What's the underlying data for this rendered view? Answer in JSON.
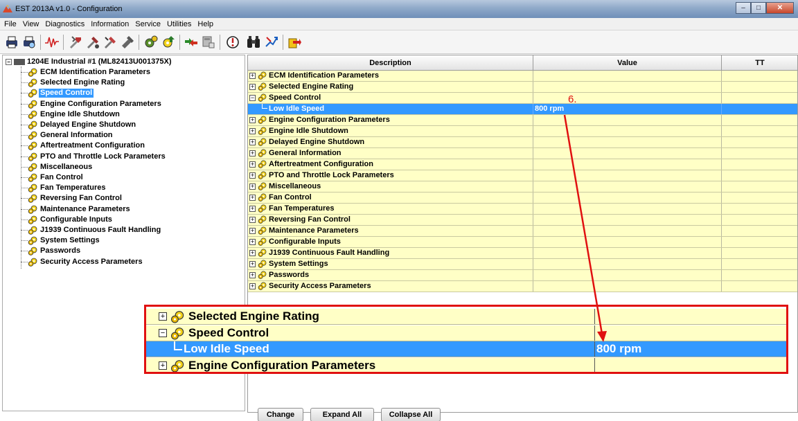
{
  "window": {
    "title": "EST 2013A v1.0 - Configuration",
    "controls": {
      "minimize": "–",
      "maximize": "□",
      "close": "✕"
    }
  },
  "menu": [
    "File",
    "View",
    "Diagnostics",
    "Information",
    "Service",
    "Utilities",
    "Help"
  ],
  "toolbar_icons": [
    "print-icon",
    "print-preview-icon",
    "waveform-icon",
    "tools-icon-1",
    "tools-icon-2",
    "tools-icon-3",
    "tools-icon-4",
    "gear-config-icon",
    "gear-upload-icon",
    "connect-icon",
    "module-icon",
    "fault-icon",
    "binoculars-icon",
    "signal-icon",
    "export-icon"
  ],
  "tree": {
    "root": "1204E Industrial #1 (ML82413U001375X)",
    "items": [
      "ECM Identification Parameters",
      "Selected Engine Rating",
      "Speed Control",
      "Engine Configuration Parameters",
      "Engine Idle Shutdown",
      "Delayed Engine Shutdown",
      "General Information",
      "Aftertreatment Configuration",
      "PTO and Throttle Lock Parameters",
      "Miscellaneous",
      "Fan Control",
      "Fan Temperatures",
      "Reversing Fan Control",
      "Maintenance Parameters",
      "Configurable Inputs",
      "J1939 Continuous Fault Handling",
      "System Settings",
      "Passwords",
      "Security Access Parameters"
    ],
    "selected": "Speed Control"
  },
  "grid": {
    "headers": {
      "description": "Description",
      "value": "Value",
      "tt": "TT"
    },
    "rows": [
      {
        "desc": "ECM Identification Parameters",
        "value": "",
        "expander": "⊞"
      },
      {
        "desc": "Selected Engine Rating",
        "value": "",
        "expander": "⊞"
      },
      {
        "desc": "Speed Control",
        "value": "",
        "expander": "⊟"
      },
      {
        "desc": "Low Idle Speed",
        "value": "800 rpm",
        "child": true
      },
      {
        "desc": "Engine Configuration Parameters",
        "value": "",
        "expander": "⊞"
      },
      {
        "desc": "Engine Idle Shutdown",
        "value": "",
        "expander": "⊞"
      },
      {
        "desc": "Delayed Engine Shutdown",
        "value": "",
        "expander": "⊞"
      },
      {
        "desc": "General Information",
        "value": "",
        "expander": "⊞"
      },
      {
        "desc": "Aftertreatment Configuration",
        "value": "",
        "expander": "⊞"
      },
      {
        "desc": "PTO and Throttle Lock Parameters",
        "value": "",
        "expander": "⊞"
      },
      {
        "desc": "Miscellaneous",
        "value": "",
        "expander": "⊞"
      },
      {
        "desc": "Fan Control",
        "value": "",
        "expander": "⊞"
      },
      {
        "desc": "Fan Temperatures",
        "value": "",
        "expander": "⊞"
      },
      {
        "desc": "Reversing Fan Control",
        "value": "",
        "expander": "⊞"
      },
      {
        "desc": "Maintenance Parameters",
        "value": "",
        "expander": "⊞"
      },
      {
        "desc": "Configurable Inputs",
        "value": "",
        "expander": "⊞"
      },
      {
        "desc": "J1939 Continuous Fault Handling",
        "value": "",
        "expander": "⊞"
      },
      {
        "desc": "System Settings",
        "value": "",
        "expander": "⊞"
      },
      {
        "desc": "Passwords",
        "value": "",
        "expander": "⊞"
      },
      {
        "desc": "Security Access Parameters",
        "value": "",
        "expander": "⊞"
      }
    ]
  },
  "zoom": {
    "rows": [
      {
        "desc": "Selected Engine Rating",
        "value": "",
        "expander": "⊞"
      },
      {
        "desc": "Speed Control",
        "value": "",
        "expander": "⊟"
      },
      {
        "desc": "Low Idle Speed",
        "value": "800 rpm",
        "child": true
      },
      {
        "desc": "Engine Configuration Parameters",
        "value": "",
        "expander": "⊞"
      }
    ]
  },
  "annotation": {
    "step": "6.",
    "color": "#e01010"
  },
  "buttons": {
    "change": "Change",
    "expand_all": "Expand All",
    "collapse_all": "Collapse All"
  },
  "colors": {
    "row_bg": "#ffffc6",
    "selected_bg": "#3399ff",
    "highlight_border": "#e01010"
  }
}
